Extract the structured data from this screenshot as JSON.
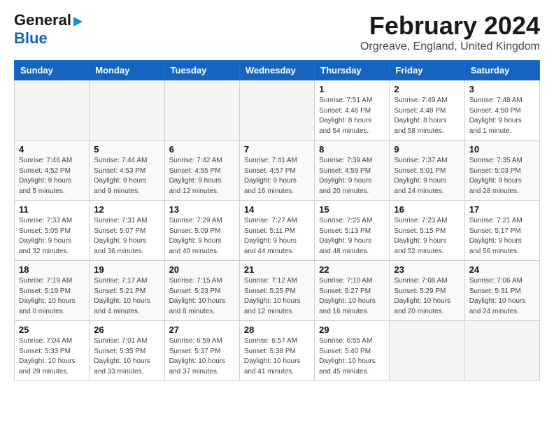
{
  "logo": {
    "line1": "General",
    "line2": "Blue"
  },
  "title": "February 2024",
  "subtitle": "Orgreave, England, United Kingdom",
  "weekdays": [
    "Sunday",
    "Monday",
    "Tuesday",
    "Wednesday",
    "Thursday",
    "Friday",
    "Saturday"
  ],
  "weeks": [
    [
      {
        "day": "",
        "detail": ""
      },
      {
        "day": "",
        "detail": ""
      },
      {
        "day": "",
        "detail": ""
      },
      {
        "day": "",
        "detail": ""
      },
      {
        "day": "1",
        "detail": "Sunrise: 7:51 AM\nSunset: 4:46 PM\nDaylight: 8 hours\nand 54 minutes."
      },
      {
        "day": "2",
        "detail": "Sunrise: 7:49 AM\nSunset: 4:48 PM\nDaylight: 8 hours\nand 58 minutes."
      },
      {
        "day": "3",
        "detail": "Sunrise: 7:48 AM\nSunset: 4:50 PM\nDaylight: 9 hours\nand 1 minute."
      }
    ],
    [
      {
        "day": "4",
        "detail": "Sunrise: 7:46 AM\nSunset: 4:52 PM\nDaylight: 9 hours\nand 5 minutes."
      },
      {
        "day": "5",
        "detail": "Sunrise: 7:44 AM\nSunset: 4:53 PM\nDaylight: 9 hours\nand 9 minutes."
      },
      {
        "day": "6",
        "detail": "Sunrise: 7:42 AM\nSunset: 4:55 PM\nDaylight: 9 hours\nand 12 minutes."
      },
      {
        "day": "7",
        "detail": "Sunrise: 7:41 AM\nSunset: 4:57 PM\nDaylight: 9 hours\nand 16 minutes."
      },
      {
        "day": "8",
        "detail": "Sunrise: 7:39 AM\nSunset: 4:59 PM\nDaylight: 9 hours\nand 20 minutes."
      },
      {
        "day": "9",
        "detail": "Sunrise: 7:37 AM\nSunset: 5:01 PM\nDaylight: 9 hours\nand 24 minutes."
      },
      {
        "day": "10",
        "detail": "Sunrise: 7:35 AM\nSunset: 5:03 PM\nDaylight: 9 hours\nand 28 minutes."
      }
    ],
    [
      {
        "day": "11",
        "detail": "Sunrise: 7:33 AM\nSunset: 5:05 PM\nDaylight: 9 hours\nand 32 minutes."
      },
      {
        "day": "12",
        "detail": "Sunrise: 7:31 AM\nSunset: 5:07 PM\nDaylight: 9 hours\nand 36 minutes."
      },
      {
        "day": "13",
        "detail": "Sunrise: 7:29 AM\nSunset: 5:09 PM\nDaylight: 9 hours\nand 40 minutes."
      },
      {
        "day": "14",
        "detail": "Sunrise: 7:27 AM\nSunset: 5:11 PM\nDaylight: 9 hours\nand 44 minutes."
      },
      {
        "day": "15",
        "detail": "Sunrise: 7:25 AM\nSunset: 5:13 PM\nDaylight: 9 hours\nand 48 minutes."
      },
      {
        "day": "16",
        "detail": "Sunrise: 7:23 AM\nSunset: 5:15 PM\nDaylight: 9 hours\nand 52 minutes."
      },
      {
        "day": "17",
        "detail": "Sunrise: 7:21 AM\nSunset: 5:17 PM\nDaylight: 9 hours\nand 56 minutes."
      }
    ],
    [
      {
        "day": "18",
        "detail": "Sunrise: 7:19 AM\nSunset: 5:19 PM\nDaylight: 10 hours\nand 0 minutes."
      },
      {
        "day": "19",
        "detail": "Sunrise: 7:17 AM\nSunset: 5:21 PM\nDaylight: 10 hours\nand 4 minutes."
      },
      {
        "day": "20",
        "detail": "Sunrise: 7:15 AM\nSunset: 5:23 PM\nDaylight: 10 hours\nand 8 minutes."
      },
      {
        "day": "21",
        "detail": "Sunrise: 7:12 AM\nSunset: 5:25 PM\nDaylight: 10 hours\nand 12 minutes."
      },
      {
        "day": "22",
        "detail": "Sunrise: 7:10 AM\nSunset: 5:27 PM\nDaylight: 10 hours\nand 16 minutes."
      },
      {
        "day": "23",
        "detail": "Sunrise: 7:08 AM\nSunset: 5:29 PM\nDaylight: 10 hours\nand 20 minutes."
      },
      {
        "day": "24",
        "detail": "Sunrise: 7:06 AM\nSunset: 5:31 PM\nDaylight: 10 hours\nand 24 minutes."
      }
    ],
    [
      {
        "day": "25",
        "detail": "Sunrise: 7:04 AM\nSunset: 5:33 PM\nDaylight: 10 hours\nand 29 minutes."
      },
      {
        "day": "26",
        "detail": "Sunrise: 7:01 AM\nSunset: 5:35 PM\nDaylight: 10 hours\nand 33 minutes."
      },
      {
        "day": "27",
        "detail": "Sunrise: 6:59 AM\nSunset: 5:37 PM\nDaylight: 10 hours\nand 37 minutes."
      },
      {
        "day": "28",
        "detail": "Sunrise: 6:57 AM\nSunset: 5:38 PM\nDaylight: 10 hours\nand 41 minutes."
      },
      {
        "day": "29",
        "detail": "Sunrise: 6:55 AM\nSunset: 5:40 PM\nDaylight: 10 hours\nand 45 minutes."
      },
      {
        "day": "",
        "detail": ""
      },
      {
        "day": "",
        "detail": ""
      }
    ]
  ]
}
